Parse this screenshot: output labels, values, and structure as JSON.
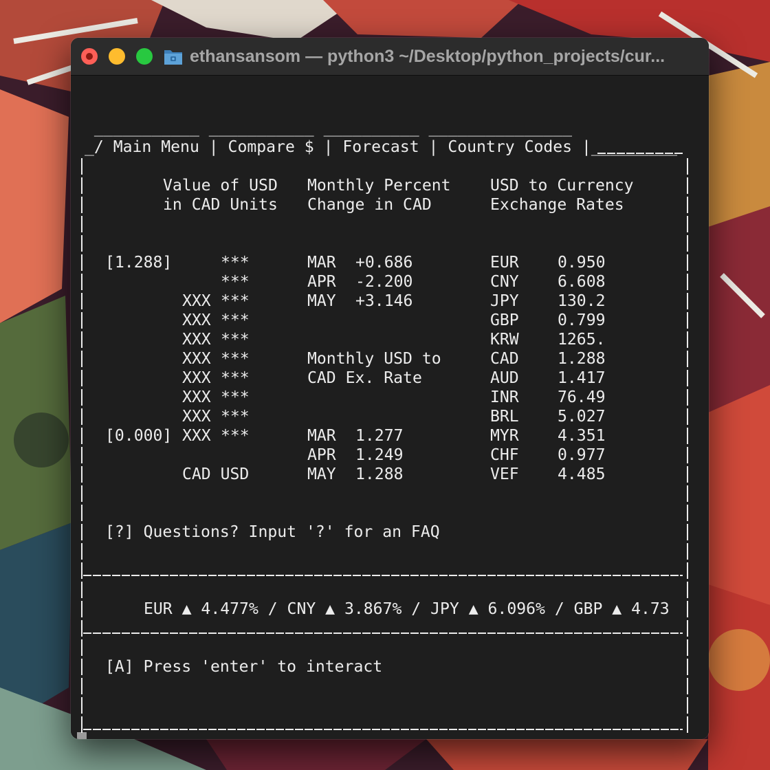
{
  "window": {
    "title": "ethansansom — python3 ~/Desktop/python_projects/cur...",
    "controls": [
      "close-button",
      "minimize-button",
      "maximize-button"
    ],
    "title_icon": "folder-icon"
  },
  "menu": {
    "tabs_top": " ___________ ___________ __________ _______________",
    "tabs_line": "_/ Main Menu | Compare $ | Forecast | Country Codes |_________",
    "items": [
      "Main Menu",
      "Compare $",
      "Forecast",
      "Country Codes"
    ]
  },
  "panel": {
    "border_top": "|                                                             |",
    "headers": {
      "value_title_1": "Value of USD",
      "value_title_2": "in CAD Units",
      "percent_title_1": "Monthly Percent",
      "percent_title_2": "Change in CAD",
      "rates_title_1": "USD to Currency",
      "rates_title_2": "Exchange Rates"
    },
    "bar_chart": {
      "max_label": "[1.288]",
      "min_label": "[0.000]",
      "cad_column": [
        "",
        "",
        "XXX",
        "XXX",
        "XXX",
        "XXX",
        "XXX",
        "XXX",
        "XXX",
        "XXX"
      ],
      "usd_column": [
        "***",
        "***",
        "***",
        "***",
        "***",
        "***",
        "***",
        "***",
        "***",
        "***"
      ],
      "footer": "CAD USD"
    },
    "percent_change": [
      {
        "month": "MAR",
        "value": "+0.686"
      },
      {
        "month": "APR",
        "value": "-2.200"
      },
      {
        "month": "MAY",
        "value": "+3.146"
      }
    ],
    "monthly_rate_title_1": "Monthly USD to",
    "monthly_rate_title_2": "CAD Ex. Rate",
    "monthly_rate": [
      {
        "month": "MAR",
        "value": "1.277"
      },
      {
        "month": "APR",
        "value": "1.249"
      },
      {
        "month": "MAY",
        "value": "1.288"
      }
    ],
    "exchange_rates": [
      {
        "code": "EUR",
        "rate": "0.950"
      },
      {
        "code": "CNY",
        "rate": "6.608"
      },
      {
        "code": "JPY",
        "rate": "130.2"
      },
      {
        "code": "GBP",
        "rate": "0.799"
      },
      {
        "code": "KRW",
        "rate": "1265."
      },
      {
        "code": "CAD",
        "rate": "1.288"
      },
      {
        "code": "AUD",
        "rate": "1.417"
      },
      {
        "code": "INR",
        "rate": "76.49"
      },
      {
        "code": "BRL",
        "rate": "5.027"
      },
      {
        "code": "MYR",
        "rate": "4.351"
      },
      {
        "code": "CHF",
        "rate": "0.977"
      },
      {
        "code": "VEF",
        "rate": "4.485"
      }
    ],
    "faq_prompt": "[?] Questions? Input '?' for an FAQ",
    "divider": "|_______________________________________________________________|",
    "ticker": "EUR ▲ 4.477% / CNY ▲ 3.867% / JPY ▲ 6.096% / GBP ▲ 4.73",
    "interact_prompt": "[A] Press 'enter' to interact"
  }
}
